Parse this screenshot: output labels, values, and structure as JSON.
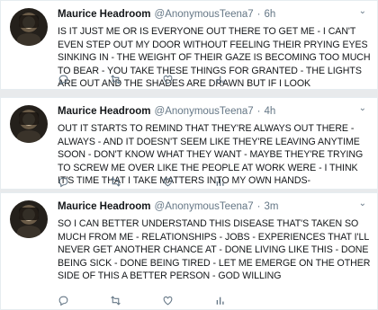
{
  "tweets": [
    {
      "name": "Maurice Headroom",
      "handle": "@AnonymousTeena7",
      "dot": "·",
      "time": "6h",
      "text": "IS IT JUST ME OR IS EVERYONE OUT THERE TO GET ME - I CAN'T EVEN STEP OUT MY DOOR WITHOUT FEELING THEIR PRYING EYES SINKING IN - THE WEIGHT OF THEIR GAZE IS BECOMING TOO MUCH TO BEAR - YOU TAKE THESE THINGS FOR GRANTED - THE LIGHTS ARE OUT AND THE SHADES ARE DRAWN BUT IF I LOOK"
    },
    {
      "name": "Maurice Headroom",
      "handle": "@AnonymousTeena7",
      "dot": "·",
      "time": "4h",
      "text": "OUT IT STARTS TO REMIND THAT THEY'RE ALWAYS OUT THERE - ALWAYS - AND IT DOESN'T SEEM LIKE THEY'RE LEAVING ANYTIME SOON - DON'T KNOW WHAT THEY WANT - MAYBE THEY'RE TRYING TO SCREW ME OVER LIKE THE PEOPLE AT WORK WERE - I THINK IT'S TIME THAT I TAKE MATTERS INTO MY OWN HANDS-"
    },
    {
      "name": "Maurice Headroom",
      "handle": "@AnonymousTeena7",
      "dot": "·",
      "time": "3m",
      "text": "SO I CAN BETTER UNDERSTAND THIS DISEASE THAT'S TAKEN SO MUCH FROM ME - RELATIONSHIPS - JOBS - EXPERIENCES THAT I'LL NEVER GET ANOTHER CHANCE AT - DONE LIVING LIKE THIS - DONE BEING SICK - DONE BEING TIRED - LET ME EMERGE ON THE OTHER SIDE OF THIS A BETTER PERSON - GOD WILLING"
    }
  ],
  "icons": {
    "more": "chevron-down-icon",
    "reply": "reply-icon",
    "retweet": "retweet-icon",
    "like": "heart-icon",
    "activity": "analytics-icon"
  },
  "colors": {
    "muted": "#657786",
    "text": "#14171a",
    "border": "#e6ecf0"
  }
}
